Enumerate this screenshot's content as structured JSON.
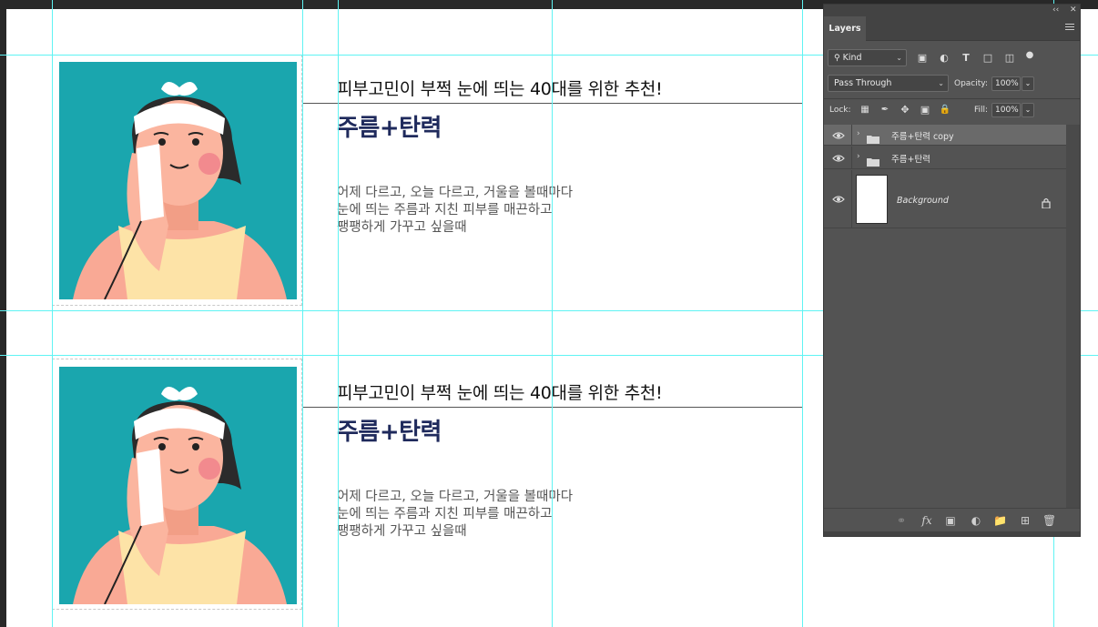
{
  "cards": [
    {
      "subtitle": "피부고민이 부쩍 눈에 띄는 40대를 위한 추천!",
      "title": "주름+탄력",
      "desc": [
        "어제 다르고, 오늘 다르고, 거울을 볼때마다",
        "눈에 띄는 주름과 지친 피부를 매끈하고",
        "팽팽하게 가꾸고 싶을때"
      ]
    },
    {
      "subtitle": "피부고민이 부쩍 눈에 띄는 40대를 위한 추천!",
      "title": "주름+탄력",
      "desc": [
        "어제 다르고, 오늘 다르고, 거울을 볼때마다",
        "눈에 띄는 주름과 지친 피부를 매끈하고",
        "팽팽하게 가꾸고 싶을때"
      ]
    }
  ],
  "panel": {
    "collapse_icon": "‹‹",
    "close_icon": "✕",
    "tab_label": "Layers",
    "filter_kind": "Kind",
    "blend_mode": "Pass Through",
    "opacity_label": "Opacity:",
    "opacity_value": "100%",
    "lock_label": "Lock:",
    "fill_label": "Fill:",
    "fill_value": "100%",
    "layers": [
      {
        "name": "주름+탄력 copy",
        "selected": true
      },
      {
        "name": "주름+탄력",
        "selected": false
      }
    ],
    "background_layer": "Background"
  },
  "colors": {
    "photo_bg": "#1aa6ae",
    "title": "#1f2a5c",
    "guide": "#5ff3f3",
    "panel_bg": "#535353"
  }
}
